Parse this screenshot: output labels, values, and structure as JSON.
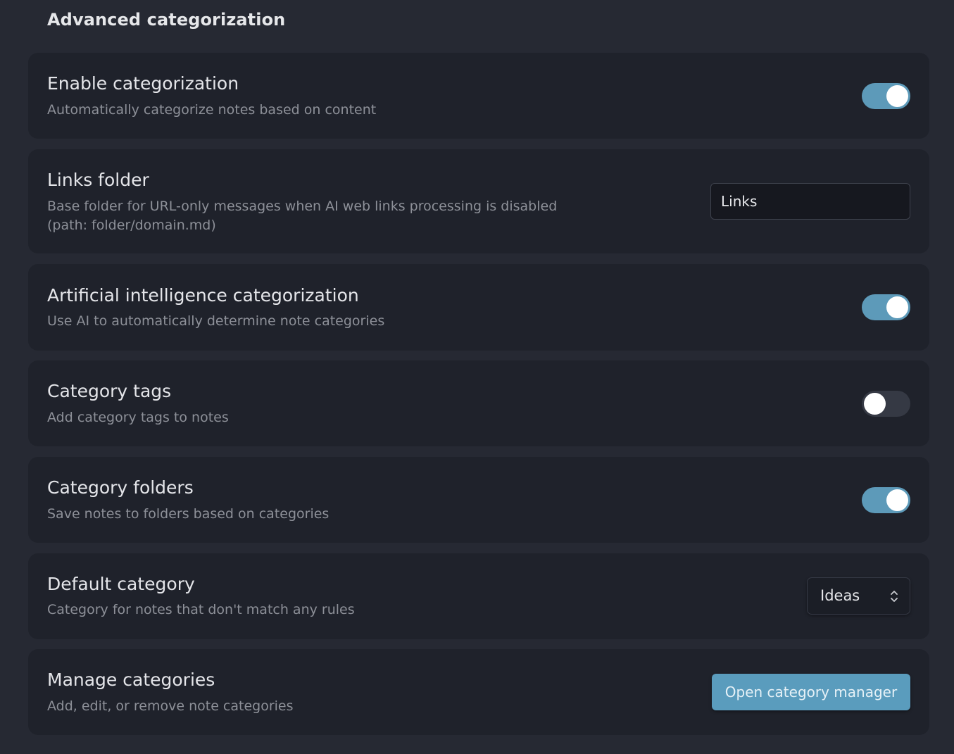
{
  "section": {
    "title": "Advanced categorization"
  },
  "settings": {
    "enable_categorization": {
      "title": "Enable categorization",
      "description": "Automatically categorize notes based on content",
      "enabled": true
    },
    "links_folder": {
      "title": "Links folder",
      "description": "Base folder for URL-only messages when AI web links processing is disabled (path: folder/domain.md)",
      "value": "Links"
    },
    "ai_categorization": {
      "title": "Artificial intelligence categorization",
      "description": "Use AI to automatically determine note categories",
      "enabled": true
    },
    "category_tags": {
      "title": "Category tags",
      "description": "Add category tags to notes",
      "enabled": false
    },
    "category_folders": {
      "title": "Category folders",
      "description": "Save notes to folders based on categories",
      "enabled": true
    },
    "default_category": {
      "title": "Default category",
      "description": "Category for notes that don't match any rules",
      "selected": "Ideas",
      "icon": "chevron-up-down-icon"
    },
    "manage_categories": {
      "title": "Manage categories",
      "description": "Add, edit, or remove note categories",
      "button_label": "Open category manager"
    }
  },
  "colors": {
    "background": "#262933",
    "card": "#1f222b",
    "accent": "#5d9ab9",
    "toggle_off": "#353944",
    "text_primary": "#e4e5e9",
    "text_muted": "#8d9098"
  }
}
